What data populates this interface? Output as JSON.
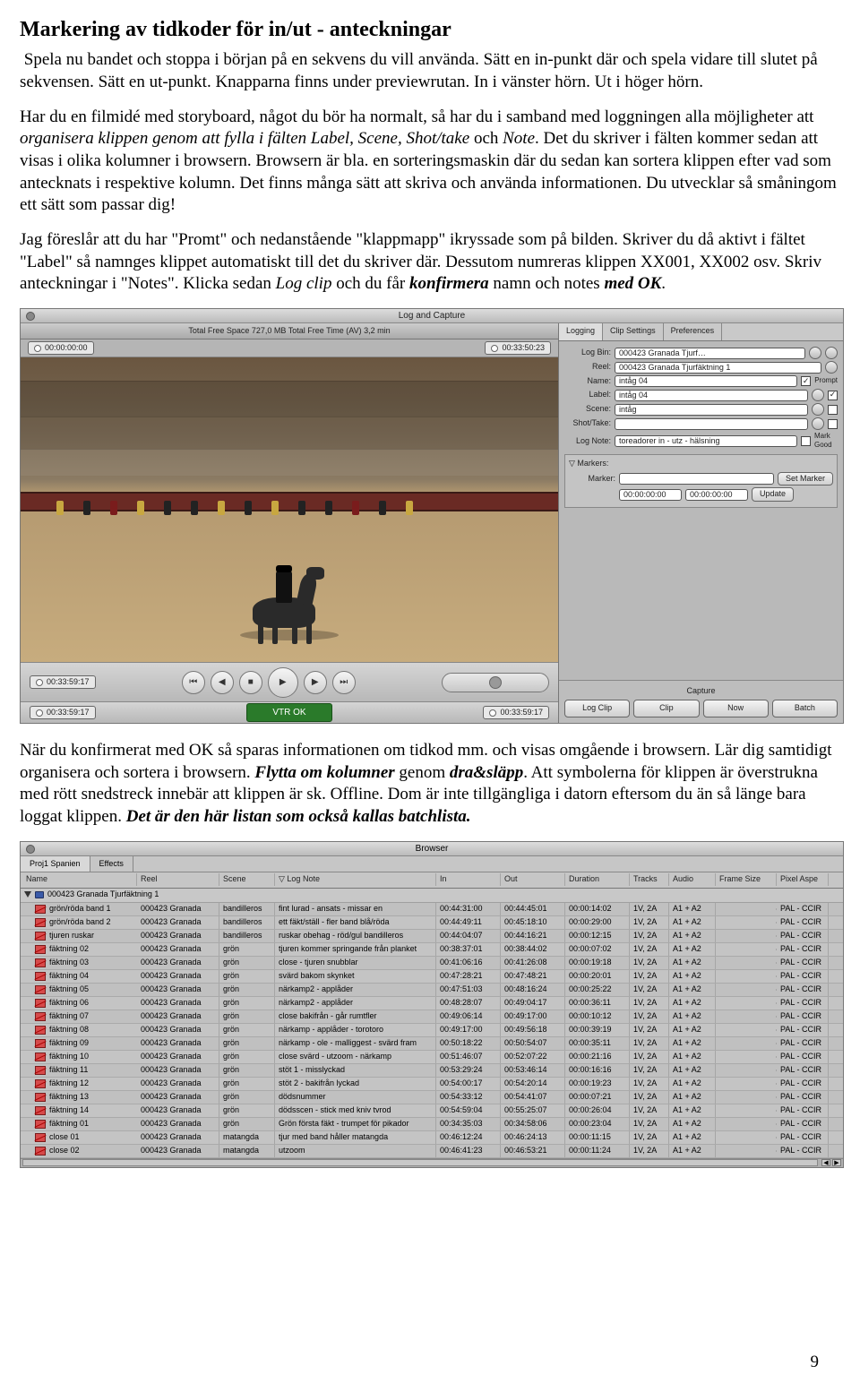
{
  "heading": "Markering av tidkoder för in/ut - anteckningar",
  "intro_prefix_icon": "",
  "intro": "Spela nu bandet och stoppa i början på en sekvens du vill använda. Sätt en in-punkt där och spela vidare till slutet på sekvensen. Sätt en ut-punkt. Knapparna finns under previewrutan. In i vänster hörn. Ut i höger hörn.",
  "para1_a": "Har du en filmidé med storyboard, något du bör ha normalt, så har du i samband med loggningen alla möjligheter att ",
  "para1_em": "organisera klippen genom att fylla i fälten Label, Scene, Shot/take",
  "para1_b": " och ",
  "para1_em2": "Note",
  "para1_c": ". Det du skriver i fälten kommer sedan att visas i olika kolumner i browsern. Browsern är bla. en sorteringsmaskin där du sedan kan sortera klippen efter vad som antecknats i respektive kolumn. Det finns många sätt att skriva och använda informationen. Du utvecklar så småningom ett sätt som passar dig!",
  "para2_a": "Jag föreslår att du har \"Promt\" och nedanstående \"klappmapp\" ikryssade som på bilden. Skriver du då aktivt i fältet \"Label\" så namnges klippet automatiskt till det du skriver där. Dessutom numreras klippen XX001, XX002 osv. Skriv anteckningar i \"Notes\". Klicka sedan ",
  "para2_em1": "Log clip",
  "para2_b": " och du får ",
  "para2_em2": "konfirmera",
  "para2_c": " namn och notes ",
  "para2_em3": "med OK",
  "para2_d": ".",
  "para3_a": "När du konfirmerat med OK så sparas informationen om tidkod mm. och visas omgående i browsern. Lär dig samtidigt organisera och sortera i browsern. ",
  "para3_em1": "Flytta om kolumner",
  "para3_b": " genom ",
  "para3_em2": "dra&släpp",
  "para3_c": ". Att symbolerna för klippen är överstrukna med rött snedstreck innebär att klippen är sk. Offline. Dom är inte tillgängliga i datorn eftersom du än så länge bara loggat klippen. ",
  "para3_em3": "Det är den här listan som också kallas batchlista.",
  "page_number": "9",
  "lc": {
    "title": "Log and Capture",
    "status": "Total Free Space  727,0 MB     Total Free Time (AV) 3,2 min",
    "tc_left": "00:00:00:00",
    "tc_right": "00:33:50:23",
    "bottom_tc1": "00:33:59:17",
    "bottom_tc2": "00:33:59:17",
    "vtr": "VTR OK",
    "tabs": [
      "Logging",
      "Clip Settings",
      "Preferences"
    ],
    "form": {
      "logbin_label": "Log Bin:",
      "logbin": "000423  Granada Tjurf…",
      "reel_label": "Reel:",
      "reel": "000423 Granada Tjurfäktning 1",
      "name_label": "Name:",
      "name": "intåg 04",
      "prompt": "Prompt",
      "label_label": "Label:",
      "label": "intåg 04",
      "scene_label": "Scene:",
      "scene": "intåg",
      "shot_label": "Shot/Take:",
      "shot": "",
      "lognote_label": "Log Note:",
      "lognote": "toreadorer in - utz - hälsning",
      "markgood": "Mark Good"
    },
    "markers": {
      "title": "Markers:",
      "marker_label": "Marker:",
      "marker_val": "",
      "set": "Set Marker",
      "tc1": "00:00:00:00",
      "tc2": "00:00:00:00",
      "update": "Update"
    },
    "capture": {
      "title": "Capture",
      "logclip": "Log Clip",
      "clip": "Clip",
      "now": "Now",
      "batch": "Batch"
    }
  },
  "browser": {
    "title": "Browser",
    "tabs": [
      "Proj1 Spanien",
      "Effects"
    ],
    "columns": [
      "Name",
      "Reel",
      "Scene",
      "Log Note",
      "In",
      "Out",
      "Duration",
      "Tracks",
      "Audio",
      "Frame Size",
      "Pixel Aspe"
    ],
    "group": "000423  Granada Tjurfäktning 1",
    "rows": [
      {
        "name": "grön/röda band 1",
        "reel": "000423 Granada",
        "scene": "bandilleros",
        "log": "fint lurad - ansats - missar en",
        "in": "00:44:31:00",
        "out": "00:44:45:01",
        "dur": "00:00:14:02",
        "tr": "1V, 2A",
        "au": "A1 + A2",
        "pa": "PAL - CCIR"
      },
      {
        "name": "grön/röda band 2",
        "reel": "000423 Granada",
        "scene": "bandilleros",
        "log": "ett fäkt/ställ - fler band blå/röda",
        "in": "00:44:49:11",
        "out": "00:45:18:10",
        "dur": "00:00:29:00",
        "tr": "1V, 2A",
        "au": "A1 + A2",
        "pa": "PAL - CCIR"
      },
      {
        "name": "tjuren ruskar",
        "reel": "000423 Granada",
        "scene": "bandilleros",
        "log": "ruskar obehag - röd/gul bandilleros",
        "in": "00:44:04:07",
        "out": "00:44:16:21",
        "dur": "00:00:12:15",
        "tr": "1V, 2A",
        "au": "A1 + A2",
        "pa": "PAL - CCIR"
      },
      {
        "name": "fäktning 02",
        "reel": "000423 Granada",
        "scene": "grön",
        "log": "tjuren kommer springande från planket",
        "in": "00:38:37:01",
        "out": "00:38:44:02",
        "dur": "00:00:07:02",
        "tr": "1V, 2A",
        "au": "A1 + A2",
        "pa": "PAL - CCIR"
      },
      {
        "name": "fäktning 03",
        "reel": "000423 Granada",
        "scene": "grön",
        "log": "close - tjuren snubblar",
        "in": "00:41:06:16",
        "out": "00:41:26:08",
        "dur": "00:00:19:18",
        "tr": "1V, 2A",
        "au": "A1 + A2",
        "pa": "PAL - CCIR"
      },
      {
        "name": "fäktning 04",
        "reel": "000423 Granada",
        "scene": "grön",
        "log": "svärd bakom skynket",
        "in": "00:47:28:21",
        "out": "00:47:48:21",
        "dur": "00:00:20:01",
        "tr": "1V, 2A",
        "au": "A1 + A2",
        "pa": "PAL - CCIR"
      },
      {
        "name": "fäktning 05",
        "reel": "000423 Granada",
        "scene": "grön",
        "log": "närkamp2 - applåder",
        "in": "00:47:51:03",
        "out": "00:48:16:24",
        "dur": "00:00:25:22",
        "tr": "1V, 2A",
        "au": "A1 + A2",
        "pa": "PAL - CCIR"
      },
      {
        "name": "fäktning 06",
        "reel": "000423 Granada",
        "scene": "grön",
        "log": "närkamp2 - applåder",
        "in": "00:48:28:07",
        "out": "00:49:04:17",
        "dur": "00:00:36:11",
        "tr": "1V, 2A",
        "au": "A1 + A2",
        "pa": "PAL - CCIR"
      },
      {
        "name": "fäktning 07",
        "reel": "000423 Granada",
        "scene": "grön",
        "log": "close bakifrån - går rumtfler",
        "in": "00:49:06:14",
        "out": "00:49:17:00",
        "dur": "00:00:10:12",
        "tr": "1V, 2A",
        "au": "A1 + A2",
        "pa": "PAL - CCIR"
      },
      {
        "name": "fäktning 08",
        "reel": "000423 Granada",
        "scene": "grön",
        "log": "närkamp - applåder - torotoro",
        "in": "00:49:17:00",
        "out": "00:49:56:18",
        "dur": "00:00:39:19",
        "tr": "1V, 2A",
        "au": "A1 + A2",
        "pa": "PAL - CCIR"
      },
      {
        "name": "fäktning 09",
        "reel": "000423 Granada",
        "scene": "grön",
        "log": "närkamp - ole - malliggest - svärd fram",
        "in": "00:50:18:22",
        "out": "00:50:54:07",
        "dur": "00:00:35:11",
        "tr": "1V, 2A",
        "au": "A1 + A2",
        "pa": "PAL - CCIR"
      },
      {
        "name": "fäktning 10",
        "reel": "000423 Granada",
        "scene": "grön",
        "log": "close svärd - utzoom - närkamp",
        "in": "00:51:46:07",
        "out": "00:52:07:22",
        "dur": "00:00:21:16",
        "tr": "1V, 2A",
        "au": "A1 + A2",
        "pa": "PAL - CCIR"
      },
      {
        "name": "fäktning 11",
        "reel": "000423 Granada",
        "scene": "grön",
        "log": "stöt 1 - misslyckad",
        "in": "00:53:29:24",
        "out": "00:53:46:14",
        "dur": "00:00:16:16",
        "tr": "1V, 2A",
        "au": "A1 + A2",
        "pa": "PAL - CCIR"
      },
      {
        "name": "fäktning 12",
        "reel": "000423 Granada",
        "scene": "grön",
        "log": "stöt 2 - bakifrån lyckad",
        "in": "00:54:00:17",
        "out": "00:54:20:14",
        "dur": "00:00:19:23",
        "tr": "1V, 2A",
        "au": "A1 + A2",
        "pa": "PAL - CCIR"
      },
      {
        "name": "fäktning 13",
        "reel": "000423 Granada",
        "scene": "grön",
        "log": "dödsnummer",
        "in": "00:54:33:12",
        "out": "00:54:41:07",
        "dur": "00:00:07:21",
        "tr": "1V, 2A",
        "au": "A1 + A2",
        "pa": "PAL - CCIR"
      },
      {
        "name": "fäktning 14",
        "reel": "000423 Granada",
        "scene": "grön",
        "log": "dödsscen - stick med kniv tvrod",
        "in": "00:54:59:04",
        "out": "00:55:25:07",
        "dur": "00:00:26:04",
        "tr": "1V, 2A",
        "au": "A1 + A2",
        "pa": "PAL - CCIR"
      },
      {
        "name": "fäktning 01",
        "reel": "000423 Granada",
        "scene": "grön",
        "log": "Grön första fäkt - trumpet för pikador",
        "in": "00:34:35:03",
        "out": "00:34:58:06",
        "dur": "00:00:23:04",
        "tr": "1V, 2A",
        "au": "A1 + A2",
        "pa": "PAL - CCIR"
      },
      {
        "name": "close 01",
        "reel": "000423 Granada",
        "scene": "matangda",
        "log": "tjur med band håller matangda",
        "in": "00:46:12:24",
        "out": "00:46:24:13",
        "dur": "00:00:11:15",
        "tr": "1V, 2A",
        "au": "A1 + A2",
        "pa": "PAL - CCIR"
      },
      {
        "name": "close 02",
        "reel": "000423 Granada",
        "scene": "matangda",
        "log": "utzoom",
        "in": "00:46:41:23",
        "out": "00:46:53:21",
        "dur": "00:00:11:24",
        "tr": "1V, 2A",
        "au": "A1 + A2",
        "pa": "PAL - CCIR"
      }
    ]
  }
}
